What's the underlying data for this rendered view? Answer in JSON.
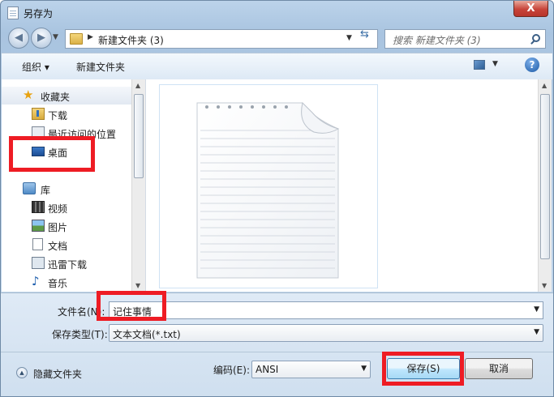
{
  "window": {
    "title": "另存为",
    "close_label": "X"
  },
  "nav": {
    "address": "新建文件夹 (3)",
    "search_placeholder": "搜索 新建文件夹 (3)"
  },
  "toolbar": {
    "organize": "组织 ▾",
    "new_folder": "新建文件夹"
  },
  "sidebar": {
    "favorites": "收藏夹",
    "downloads": "下载",
    "recent": "最近访问的位置",
    "desktop": "桌面",
    "libraries": "库",
    "videos": "视频",
    "pictures": "图片",
    "documents": "文档",
    "xunlei": "迅雷下载",
    "music": "音乐"
  },
  "form": {
    "filename_label": "文件名(N):",
    "filename_value": "记住事情",
    "filetype_label": "保存类型(T):",
    "filetype_value": "文本文档(*.txt)",
    "hide_folders": "隐藏文件夹",
    "encoding_label": "编码(E):",
    "encoding_value": "ANSI",
    "save": "保存(S)",
    "cancel": "取消"
  },
  "colors": {
    "highlight": "#ee1c24",
    "title_bg": "#bcd3ea"
  }
}
